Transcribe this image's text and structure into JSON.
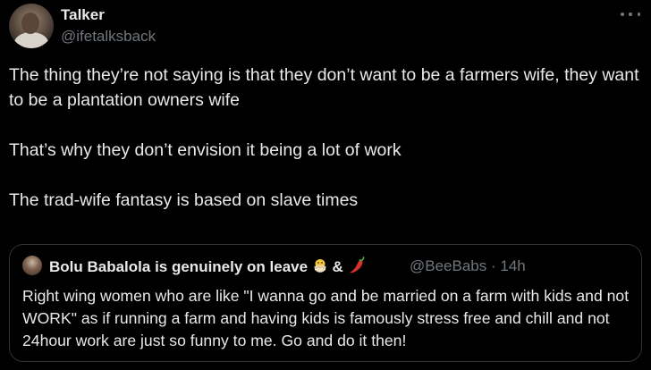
{
  "author": {
    "display_name": "Talker",
    "handle": "@ifetalksback"
  },
  "tweet": {
    "paragraphs": [
      "The thing they’re not saying is that they don’t want to be a farmers wife, they want to be a plantation owners wife",
      "That’s why they don’t envision it being a lot of work",
      "The trad-wife fantasy is based on slave times"
    ]
  },
  "quote": {
    "display_name": "Bolu Babalola is genuinely on leave",
    "name_symbol": "&",
    "handle_time": "@BeeBabs · 14h",
    "text": "Right wing women who are like \"I wanna go and be married on a farm with kids and not WORK\" as if running a farm and having kids is famously stress free and chill and not 24hour work are just so funny to me. Go and do it then!",
    "emojis": [
      "hatching-chick-emoji",
      "chili-pepper-emoji"
    ]
  },
  "icons": {
    "more": "more-options-icon"
  },
  "colors": {
    "background": "#000000",
    "text": "#e7e9ea",
    "muted": "#71767b",
    "border": "#2f3336"
  }
}
